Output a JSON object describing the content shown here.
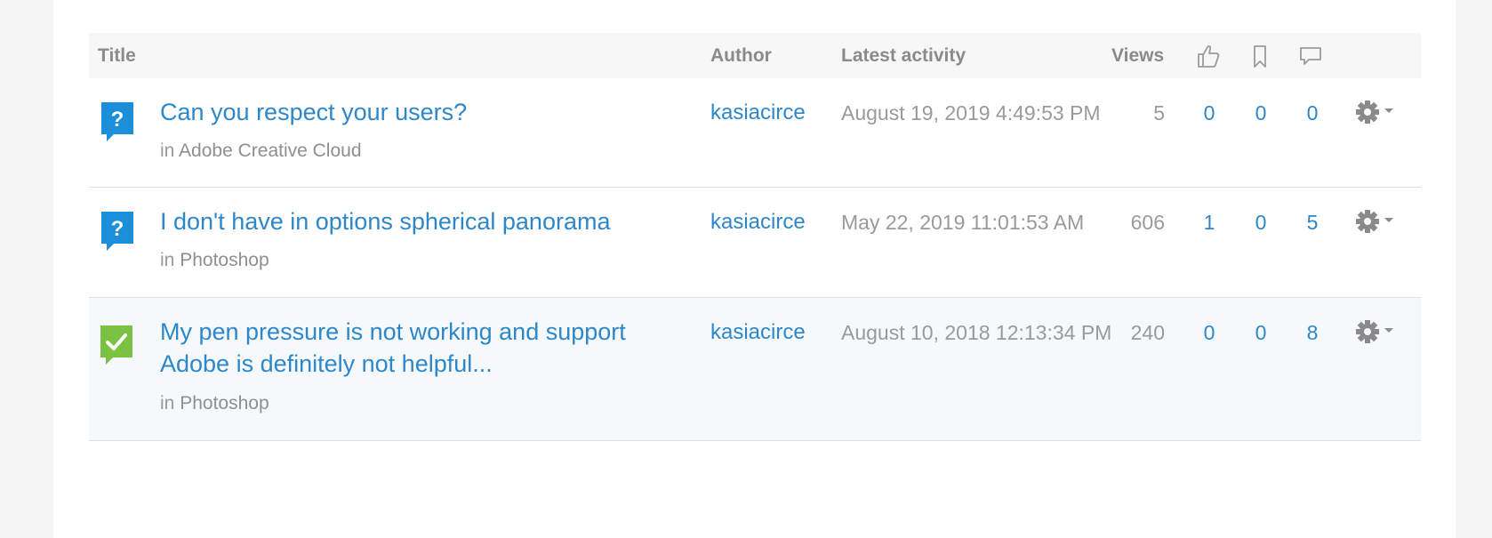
{
  "header": {
    "title": "Title",
    "author": "Author",
    "latest_activity": "Latest activity",
    "views": "Views",
    "likes_icon": "thumbs-up-icon",
    "bookmarks_icon": "bookmark-icon",
    "replies_icon": "comment-icon"
  },
  "rows": [
    {
      "status_icon": "question-icon",
      "title": "Can you respect your users?",
      "place_prefix": "in",
      "place": "Adobe Creative Cloud",
      "author": "kasiacirce",
      "activity": "August 19, 2019 4:49:53 PM",
      "views": "5",
      "likes": "0",
      "bookmarks": "0",
      "replies": "0"
    },
    {
      "status_icon": "question-icon",
      "title": "I don't have in options spherical panorama",
      "place_prefix": "in",
      "place": "Photoshop",
      "author": "kasiacirce",
      "activity": "May 22, 2019 11:01:53 AM",
      "views": "606",
      "likes": "1",
      "bookmarks": "0",
      "replies": "5"
    },
    {
      "status_icon": "answered-check-icon",
      "title": "My pen pressure is not working and support Adobe is definitely not helpful...",
      "place_prefix": "in",
      "place": "Photoshop",
      "author": "kasiacirce",
      "activity": "August 10, 2018 12:13:34 PM",
      "views": "240",
      "likes": "0",
      "bookmarks": "0",
      "replies": "8"
    }
  ],
  "colors": {
    "link": "#2d87c8",
    "question_icon": "#1b8fd9",
    "answered_icon": "#7cc242",
    "muted_text": "#9a9a9a",
    "header_bg": "#f7f7f7",
    "highlight_row_bg": "#f5f9fc"
  },
  "actions_icon": "gear-icon"
}
